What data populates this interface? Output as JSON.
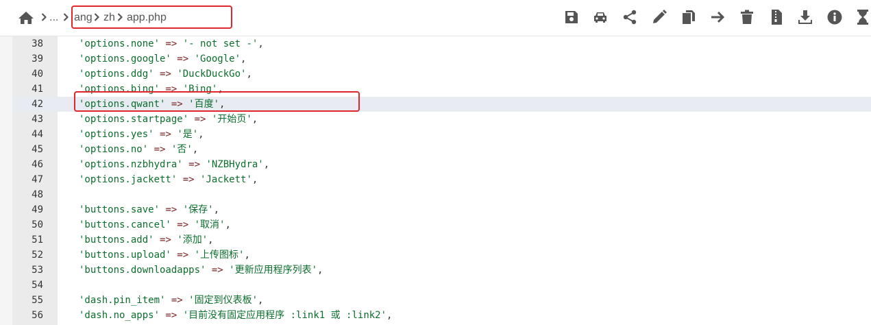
{
  "breadcrumb": {
    "home_icon": "home-icon",
    "ellipsis": "...",
    "segments": [
      "ang",
      "zh",
      "app.php"
    ]
  },
  "toolbar": {
    "buttons": [
      {
        "name": "save-button",
        "icon": "save-icon"
      },
      {
        "name": "vehicle-button",
        "icon": "car-icon"
      },
      {
        "name": "share-button",
        "icon": "share-icon"
      },
      {
        "name": "edit-button",
        "icon": "pencil-icon"
      },
      {
        "name": "copy-button",
        "icon": "copy-icon"
      },
      {
        "name": "move-button",
        "icon": "arrow-right-icon"
      },
      {
        "name": "delete-button",
        "icon": "trash-icon"
      },
      {
        "name": "archive-button",
        "icon": "zip-file-icon"
      },
      {
        "name": "download-button",
        "icon": "download-icon"
      },
      {
        "name": "info-button",
        "icon": "info-icon"
      },
      {
        "name": "history-button",
        "icon": "hourglass-icon"
      }
    ]
  },
  "colors": {
    "string": "#0b6e2d",
    "operator": "#7a1f1f",
    "highlight_border": "#e0262b",
    "active_line": "#e8ecf2"
  },
  "editor": {
    "active_line": 42,
    "lines": [
      {
        "num": "38",
        "key": "'options.none'",
        "op": "=>",
        "value": "'- not set -'",
        "punct": ","
      },
      {
        "num": "39",
        "key": "'options.google'",
        "op": "=>",
        "value": "'Google'",
        "punct": ","
      },
      {
        "num": "40",
        "key": "'options.ddg'",
        "op": "=>",
        "value": "'DuckDuckGo'",
        "punct": ","
      },
      {
        "num": "41",
        "key": "'options.bing'",
        "op": "=>",
        "value": "'Bing'",
        "punct": ","
      },
      {
        "num": "42",
        "key": "'options.qwant'",
        "op": "=>",
        "value": "'百度'",
        "punct": ","
      },
      {
        "num": "43",
        "key": "'options.startpage'",
        "op": "=>",
        "value": "'开始页'",
        "punct": ","
      },
      {
        "num": "44",
        "key": "'options.yes'",
        "op": "=>",
        "value": "'是'",
        "punct": ","
      },
      {
        "num": "45",
        "key": "'options.no'",
        "op": "=>",
        "value": "'否'",
        "punct": ","
      },
      {
        "num": "46",
        "key": "'options.nzbhydra'",
        "op": "=>",
        "value": "'NZBHydra'",
        "punct": ","
      },
      {
        "num": "47",
        "key": "'options.jackett'",
        "op": "=>",
        "value": "'Jackett'",
        "punct": ","
      },
      {
        "num": "48",
        "key": "",
        "op": "",
        "value": "",
        "punct": ""
      },
      {
        "num": "49",
        "key": "'buttons.save'",
        "op": "=>",
        "value": "'保存'",
        "punct": ","
      },
      {
        "num": "50",
        "key": "'buttons.cancel'",
        "op": "=>",
        "value": "'取消'",
        "punct": ","
      },
      {
        "num": "51",
        "key": "'buttons.add'",
        "op": "=>",
        "value": "'添加'",
        "punct": ","
      },
      {
        "num": "52",
        "key": "'buttons.upload'",
        "op": "=>",
        "value": "'上传图标'",
        "punct": ","
      },
      {
        "num": "53",
        "key": "'buttons.downloadapps'",
        "op": "=>",
        "value": "'更新应用程序列表'",
        "punct": ","
      },
      {
        "num": "54",
        "key": "",
        "op": "",
        "value": "",
        "punct": ""
      },
      {
        "num": "55",
        "key": "'dash.pin_item'",
        "op": "=>",
        "value": "'固定到仪表板'",
        "punct": ","
      },
      {
        "num": "56",
        "key": "'dash.no_apps'",
        "op": "=>",
        "value": "'目前没有固定应用程序 :link1 或 :link2'",
        "punct": ","
      }
    ]
  }
}
